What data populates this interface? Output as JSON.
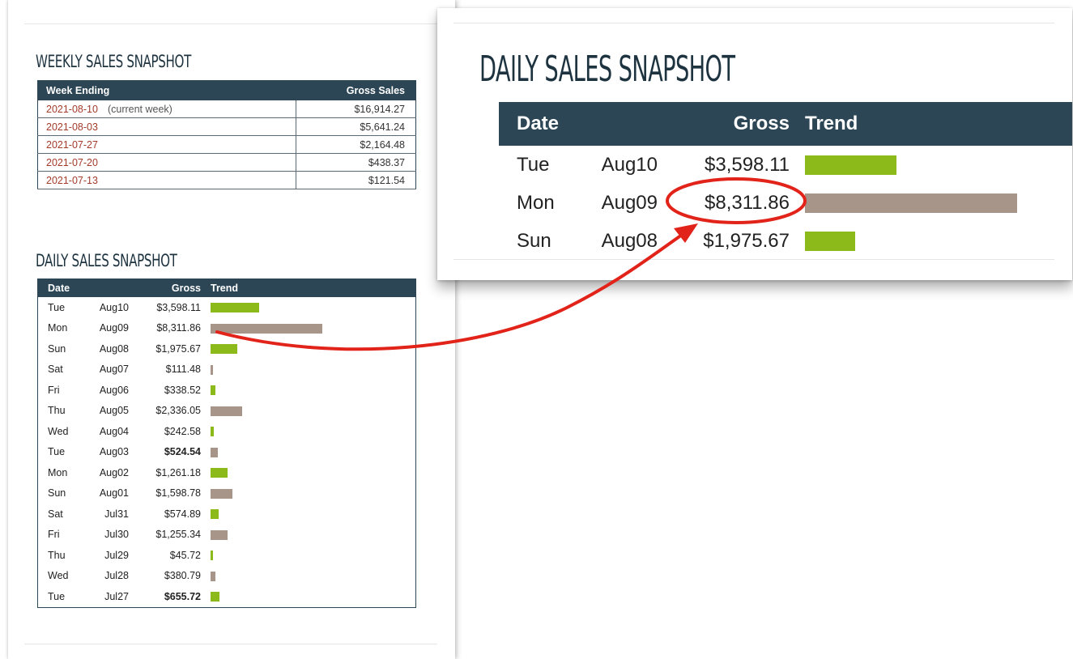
{
  "weekly": {
    "title": "WEEKLY SALES SNAPSHOT",
    "columns": [
      "Week Ending",
      "Gross Sales"
    ],
    "rows": [
      {
        "week": "2021-08-10",
        "note": "(current week)",
        "gross": "$16,914.27"
      },
      {
        "week": "2021-08-03",
        "note": "",
        "gross": "$5,641.24"
      },
      {
        "week": "2021-07-27",
        "note": "",
        "gross": "$2,164.48"
      },
      {
        "week": "2021-07-20",
        "note": "",
        "gross": "$438.37"
      },
      {
        "week": "2021-07-13",
        "note": "",
        "gross": "$121.54"
      }
    ]
  },
  "daily": {
    "title": "DAILY SALES SNAPSHOT",
    "columns": [
      "Date",
      "Gross",
      "Trend"
    ],
    "rows": [
      {
        "day": "Tue",
        "date": "Aug10",
        "gross": "$3,598.11",
        "value": 3598.11,
        "trend": "up",
        "bold": false
      },
      {
        "day": "Mon",
        "date": "Aug09",
        "gross": "$8,311.86",
        "value": 8311.86,
        "trend": "down",
        "bold": false
      },
      {
        "day": "Sun",
        "date": "Aug08",
        "gross": "$1,975.67",
        "value": 1975.67,
        "trend": "up",
        "bold": false
      },
      {
        "day": "Sat",
        "date": "Aug07",
        "gross": "$111.48",
        "value": 111.48,
        "trend": "down",
        "bold": false
      },
      {
        "day": "Fri",
        "date": "Aug06",
        "gross": "$338.52",
        "value": 338.52,
        "trend": "up",
        "bold": false
      },
      {
        "day": "Thu",
        "date": "Aug05",
        "gross": "$2,336.05",
        "value": 2336.05,
        "trend": "down",
        "bold": false
      },
      {
        "day": "Wed",
        "date": "Aug04",
        "gross": "$242.58",
        "value": 242.58,
        "trend": "up",
        "bold": false
      },
      {
        "day": "Tue",
        "date": "Aug03",
        "gross": "$524.54",
        "value": 524.54,
        "trend": "down",
        "bold": true
      },
      {
        "day": "Mon",
        "date": "Aug02",
        "gross": "$1,261.18",
        "value": 1261.18,
        "trend": "up",
        "bold": false
      },
      {
        "day": "Sun",
        "date": "Aug01",
        "gross": "$1,598.78",
        "value": 1598.78,
        "trend": "down",
        "bold": false
      },
      {
        "day": "Sat",
        "date": "Jul31",
        "gross": "$574.89",
        "value": 574.89,
        "trend": "up",
        "bold": false
      },
      {
        "day": "Fri",
        "date": "Jul30",
        "gross": "$1,255.34",
        "value": 1255.34,
        "trend": "down",
        "bold": false
      },
      {
        "day": "Thu",
        "date": "Jul29",
        "gross": "$45.72",
        "value": 45.72,
        "trend": "up",
        "bold": false
      },
      {
        "day": "Wed",
        "date": "Jul28",
        "gross": "$380.79",
        "value": 380.79,
        "trend": "down",
        "bold": false
      },
      {
        "day": "Tue",
        "date": "Jul27",
        "gross": "$655.72",
        "value": 655.72,
        "trend": "up",
        "bold": true
      }
    ]
  },
  "zoom": {
    "title": "DAILY SALES SNAPSHOT",
    "columns": [
      "Date",
      "Gross",
      "Trend"
    ],
    "rows": [
      {
        "day": "Tue",
        "date": "Aug10",
        "gross": "$3,598.11",
        "value": 3598.11,
        "trend": "up"
      },
      {
        "day": "Mon",
        "date": "Aug09",
        "gross": "$8,311.86",
        "value": 8311.86,
        "trend": "down"
      },
      {
        "day": "Sun",
        "date": "Aug08",
        "gross": "$1,975.67",
        "value": 1975.67,
        "trend": "up"
      }
    ]
  },
  "colors": {
    "header_bg": "#2c4656",
    "trend_up": "#8cba1a",
    "trend_down": "#a8958a",
    "week_link": "#a33b2a",
    "annotation_red": "#e2231a"
  }
}
